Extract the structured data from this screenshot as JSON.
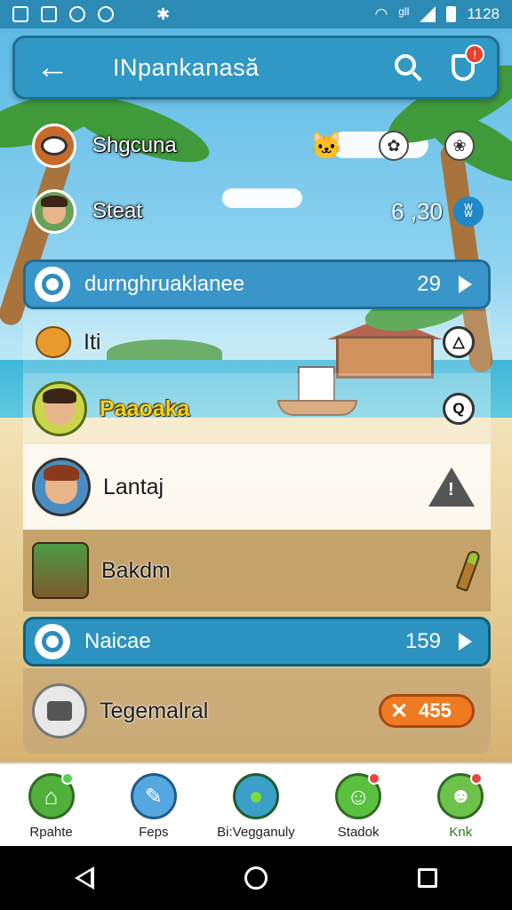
{
  "status_bar": {
    "time": "1128",
    "signal_text": "ᵍᴵᴵ"
  },
  "top_bar": {
    "title": "INpankanasă",
    "notification_count": "!"
  },
  "header_rows": [
    {
      "name": "Shgcuna",
      "icon": "cat-icon"
    },
    {
      "name": "Steat",
      "score": "6 ,30"
    }
  ],
  "sections": [
    {
      "label": "durnghruaklanee",
      "count": "29"
    },
    {
      "label": "Naicae",
      "count": "159"
    }
  ],
  "list_items": [
    {
      "name": "Iti"
    },
    {
      "name": "Paaoaka"
    },
    {
      "name": "Lantaj"
    },
    {
      "name": "Bakdm"
    },
    {
      "name": "Tegemalral",
      "badge_count": "455"
    }
  ],
  "bottom_nav": [
    {
      "label": "Rpahte"
    },
    {
      "label": "Feps"
    },
    {
      "label": "Bi:Vegganuly"
    },
    {
      "label": "Stadok"
    },
    {
      "label": "Knk"
    }
  ],
  "colors": {
    "accent": "#2f98c4",
    "badge_orange": "#f07a22",
    "nav_active": "#2e7d1f",
    "highlight_name": "#f5d21b"
  }
}
